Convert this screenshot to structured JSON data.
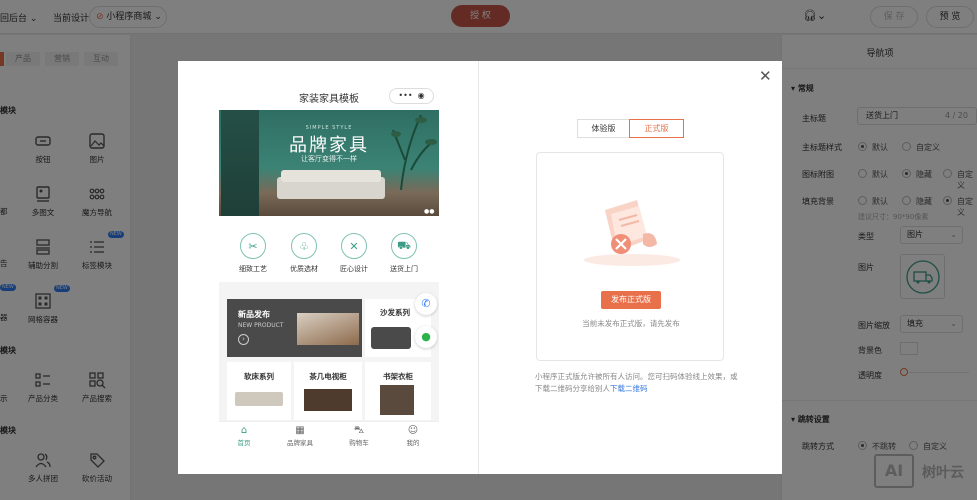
{
  "topbar": {
    "back": "回后台",
    "current_label": "当前设计",
    "current_app": "小程序商城",
    "auth_button": "授 权",
    "save_button": "保 存",
    "preview_button": "预 览"
  },
  "left": {
    "tabs": [
      "产品",
      "营销",
      "互动"
    ],
    "section1": "模块",
    "section2": "模块",
    "section3": "模块",
    "items": {
      "button": "按钮",
      "image": "图片",
      "multi_image": "多图文",
      "magic_nav": "魔方导航",
      "divider": "辅助分割",
      "tab_module": "标签模块",
      "grid": "网格容器",
      "product_cat": "产品分类",
      "product_search": "产品搜索",
      "group_buy": "多人拼团",
      "bargain": "砍价活动"
    },
    "partials": {
      "p1": "都",
      "p2": "告",
      "p3": "器",
      "p4": "示"
    },
    "new_badge": "NEW"
  },
  "right": {
    "title": "导航项",
    "section_general": "常规",
    "main_title_label": "主标题",
    "main_title_value": "送货上门",
    "main_title_count": "4 / 20",
    "title_style_label": "主标题样式",
    "opt_default": "默认",
    "opt_custom": "自定义",
    "icon_img_label": "图标附图",
    "opt_hide": "隐藏",
    "opt_custom_short": "自定义",
    "fill_bg_label": "填充背景",
    "size_hint": "建议尺寸：90*90像素",
    "type_label": "类型",
    "type_value": "图片",
    "image_label": "图片",
    "scale_label": "图片缩放",
    "scale_value": "填充",
    "bgcolor_label": "背景色",
    "opacity_label": "透明度",
    "section_jump": "跳转设置",
    "jump_label": "跳转方式",
    "opt_nojump": "不跳转",
    "opt_custom2": "自定义"
  },
  "phone": {
    "title": "家装家具模板",
    "banner_title": "品牌家具",
    "banner_sub": "让客厅变得不一样",
    "banner_top": "SIMPLE STYLE",
    "cats": [
      "细致工艺",
      "优质选材",
      "匠心设计",
      "送货上门"
    ],
    "new_release": "新品发布",
    "new_product": "NEW PRODUCT",
    "sofa": "沙发系列",
    "bed": "软床系列",
    "tea_table": "茶几电视柜",
    "bookcase": "书架衣柜",
    "tabs": [
      "首页",
      "品牌家具",
      "购物车",
      "我的"
    ]
  },
  "modal": {
    "tab_trial": "体验版",
    "tab_release": "正式版",
    "publish_button": "发布正式版",
    "empty_text": "当前未发布正式版，请先发布",
    "desc": "小程序正式版允许被所有人访问。您可扫码体验线上效果，或下载二维码分享给别人",
    "download_link": "下载二维码"
  },
  "watermark": "树叶云",
  "colors": {
    "accent": "#e8704a",
    "primary": "#c9574a",
    "teal": "#3c9c86"
  }
}
